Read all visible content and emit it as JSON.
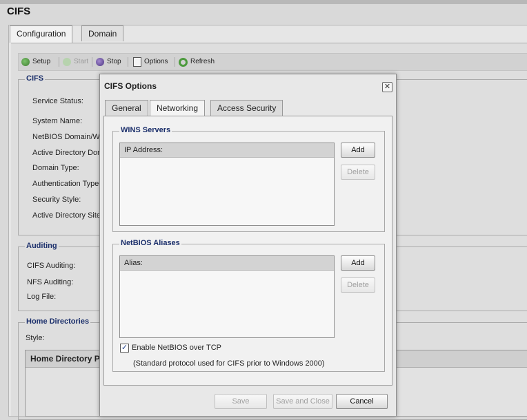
{
  "app": {
    "title": "CIFS"
  },
  "main_tabs": [
    {
      "label": "Configuration",
      "active": true
    },
    {
      "label": "Domain",
      "active": false
    }
  ],
  "toolbar": {
    "setup": "Setup",
    "start": "Start",
    "stop": "Stop",
    "options": "Options",
    "refresh": "Refresh"
  },
  "cifs_section": {
    "legend": "CIFS",
    "labels": [
      "Service Status:",
      "System Name:",
      "NetBIOS Domain/W",
      "Active Directory Dor",
      "Domain Type:",
      "Authentication Type",
      "Security Style:",
      "Active Directory Site"
    ]
  },
  "auditing_section": {
    "legend": "Auditing",
    "labels": [
      "CIFS Auditing:",
      "NFS Auditing:",
      "Log File:"
    ]
  },
  "home_section": {
    "legend": "Home Directories",
    "style_label": "Style:",
    "table_header": "Home Directory P"
  },
  "dialog": {
    "title": "CIFS Options",
    "close_glyph": "✕",
    "tabs": [
      {
        "label": "General",
        "active": false
      },
      {
        "label": "Networking",
        "active": true
      },
      {
        "label": "Access Security",
        "active": false
      }
    ],
    "wins": {
      "legend": "WINS Servers",
      "column_header": "IP Address:",
      "add_label": "Add",
      "delete_label": "Delete"
    },
    "netbios": {
      "legend": "NetBIOS Aliases",
      "column_header": "Alias:",
      "add_label": "Add",
      "delete_label": "Delete",
      "checkbox_label": "Enable NetBIOS over TCP",
      "checkbox_checked": true,
      "checkbox_glyph": "✓",
      "note": "(Standard protocol used for CIFS prior to Windows 2000)"
    },
    "footer": {
      "save_label": "Save",
      "save_close_label": "Save and Close",
      "cancel_label": "Cancel"
    }
  }
}
